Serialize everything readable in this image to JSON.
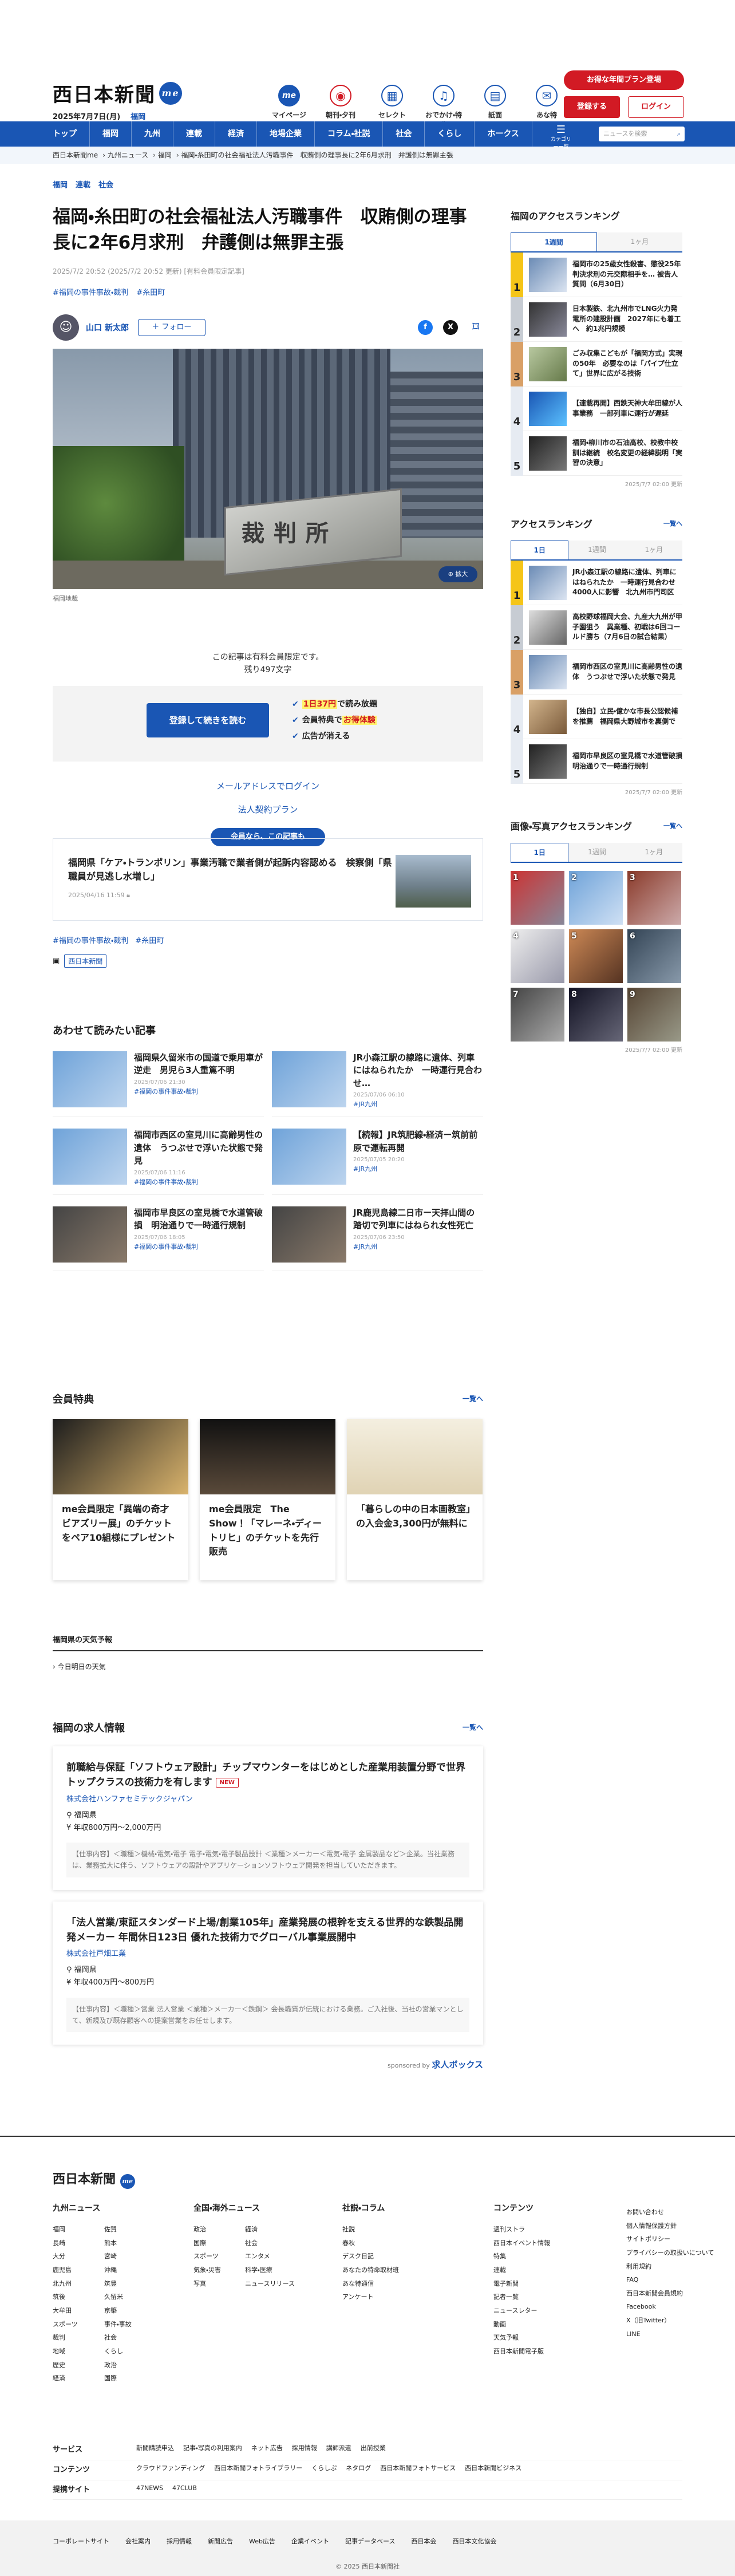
{
  "header": {
    "logo": "西日本新聞",
    "logo_me": "me",
    "date": "2025年7月7日(月)",
    "region": "福岡",
    "icons": [
      {
        "label": "マイページ",
        "icon": "me-icon"
      },
      {
        "label": "朝刊・夕刊",
        "icon": "newspaper-icon"
      },
      {
        "label": "セレクト",
        "icon": "select-icon"
      },
      {
        "label": "おでかけ・特典",
        "icon": "outing-icon"
      },
      {
        "label": "紙面",
        "icon": "paper-icon"
      },
      {
        "label": "あな特",
        "icon": "anatoku-icon"
      }
    ],
    "campaign": "お得な年間プラン登場",
    "register": "登録する",
    "login": "ログイン"
  },
  "gnav": {
    "items": [
      "トップ",
      "福岡",
      "九州",
      "連載",
      "経済",
      "地場企業",
      "コラム・社説",
      "社会",
      "くらし",
      "ホークス"
    ],
    "category_menu": "カテゴリー一覧",
    "search_placeholder": "ニュースを検索"
  },
  "breadcrumb": [
    "西日本新聞me",
    "九州ニュース",
    "福岡",
    "福岡・糸田町の社会福祉法人汚職事件　収賄側の理事長に2年6月求刑　弁護側は無罪主張"
  ],
  "article": {
    "tags": [
      "福岡",
      "連載",
      "社会"
    ],
    "title": "福岡・糸田町の社会福祉法人汚職事件　収賄側の理事長に2年6月求刑　弁護側は無罪主張",
    "date": "2025/7/2 20:52 (2025/7/2 20:52 更新) [有料会員限定記事]",
    "categories": [
      "#福岡の事件事故・裁判",
      "#糸田町"
    ],
    "author": "山口 新太郎",
    "follow": "＋ フォロー",
    "photo_sign": "裁判所",
    "zoom": "拡大",
    "caption": "福岡地裁",
    "pay_msg1": "この記事は有料会員限定です。",
    "pay_msg2": "残り497文字",
    "pay_btn": "登録して続きを読む",
    "perk1_pre": "1日37円",
    "perk1_post": "で読み放題",
    "perk2_pre": "会員特典で",
    "perk2_hl": "お得体験",
    "perk3": "広告が消える",
    "mail_login": "メールアドレスでログイン",
    "corp_plan": "法人契約プラン",
    "ribbon": "会員なら、この記事も",
    "next_title": "福岡県「ケア・トランポリン」事業汚職で業者側が起訴内容認める　検察側「県職員が見逃し水増し」",
    "next_date": "2025/04/16 11:59",
    "tags2": [
      "#福岡の事件事故・裁判",
      "#糸田町"
    ],
    "publisher": "西日本新聞"
  },
  "related": {
    "title": "あわせて読みたい記事",
    "items": [
      {
        "title": "福岡県久留米市の国道で乗用車が逆走　男児ら3人重篤不明",
        "date": "2025/07/06 21:30",
        "cat": "#福岡の事件事故・裁判"
      },
      {
        "title": "JR小森江駅の線路に遺体、列車にはねられたか　一時運行見合わせ…",
        "date": "2025/07/06 06:10",
        "cat": "#JR九州"
      },
      {
        "title": "福岡市西区の室見川に高齢男性の遺体　うつぶせで浮いた状態で発見",
        "date": "2025/07/06 11:16",
        "cat": "#福岡の事件事故・裁判"
      },
      {
        "title": "【続報】JR筑肥線・経済ー筑前前原で運転再開",
        "date": "2025/07/05 20:20",
        "cat": "#JR九州"
      },
      {
        "title": "福岡市早良区の室見橋で水道管破損　明治通りで一時通行規制",
        "date": "2025/07/06 18:05",
        "cat": "#福岡の事件事故・裁判"
      },
      {
        "title": "JR鹿児島線二日市ー天拝山間の踏切で列車にはねられ女性死亡",
        "date": "2025/07/06 23:50",
        "cat": "#JR九州"
      }
    ]
  },
  "members": {
    "title": "会員特典",
    "more": "一覧へ",
    "items": [
      {
        "title": "me会員限定「異端の奇才 ビアズリー展」のチケットをペア10組様にプレゼント"
      },
      {
        "title": "me会員限定　The Show！「マレーネ・ディートリヒ」のチケットを先行販売"
      },
      {
        "title": "「暮らしの中の日本画教室」の入会金3,300円が無料に"
      }
    ]
  },
  "weather": {
    "title": "福岡県の天気予報",
    "link": "今日明日の天気"
  },
  "jobs": {
    "title": "福岡の求人情報",
    "more": "一覧へ",
    "items": [
      {
        "title": "前職給与保証「ソフトウェア設計」チップマウンターをはじめとした産業用装置分野で世界トップクラスの技術力を有します",
        "new": "NEW",
        "company": "株式会社ハンファセミテックジャパン",
        "place": "福岡県",
        "salary": "年収800万円〜2,000万円",
        "desc": "【仕事内容】＜職種＞機械・電気・電子 電子・電気・電子製品設計 ＜業種＞メーカー＜電気・電子 金属製品など＞企業。当社業務は、業務拡大に伴う、ソフトウェアの設計やアプリケーションソフトウェア開発を担当していただきます。"
      },
      {
        "title": "「法人営業/東証スタンダード上場/創業105年」産業発展の根幹を支える世界的な鉄製品開発メーカー 年間休日123日 優れた技術力でグローバル事業展開中",
        "new": "",
        "company": "株式会社戸畑工業",
        "place": "福岡県",
        "salary": "年収400万円〜800万円",
        "desc": "【仕事内容】＜職種＞営業 法人営業 ＜業種＞メーカー＜鉄鋼＞ 会長職質が伝統における業務。ご入社後、当社の営業マンとして、新規及び既存顧客への提案営業をお任せします。"
      }
    ],
    "sponsor": "sponsored by",
    "sponsor_name": "求人ボックス"
  },
  "side": {
    "area_title": "福岡のアクセスランキング",
    "area_tabs": [
      "1週間",
      "1ヶ月"
    ],
    "area_items": [
      "福岡市の25歳女性殺害、懲役25年判決求刑の元交際相手を… 被告人質問（6月30日）",
      "日本製鉄、北九州市でLNG火力発電所の建設計画　2027年にも着工へ　約1兆円規模",
      "ごみ収集こどもが「福岡方式」実現の50年　必要なのは「パイプ仕立て」世界に広がる技術",
      "【連載再開】西鉄天神大牟田線が人事業務　一部列車に運行が遅延",
      "福岡・柳川市の石油高校、校教中校訓は継続　校名変更の経緯説明「実習の決意」"
    ],
    "area_updated": "2025/7/7 02:00 更新",
    "access_title": "アクセスランキング",
    "access_more": "一覧へ",
    "access_tabs": [
      "1日",
      "1週間",
      "1ヶ月"
    ],
    "access_items": [
      "JR小森江駅の線路に遺体、列車にはねられたか　一時運行見合わせ4000人に影響　北九州市門司区",
      "高校野球福岡大会、九産大九州が甲子園狙う　異業種、初戦は6回コールド勝ち（7月6日の試合結果）",
      "福岡市西区の室見川に高齢男性の遺体　うつぶせで浮いた状態で発見",
      "【独自】立民・億かな市長公認候補を推薦　福岡県大野城市を裏側で",
      "福岡市早良区の室見橋で水道管破損　明治通りで一時通行規制"
    ],
    "access_updated": "2025/7/7 02:00 更新",
    "photo_title": "画像・写真アクセスランキング",
    "photo_more": "一覧へ",
    "photo_tabs": [
      "1日",
      "1週間",
      "1ヶ月"
    ],
    "photo_nums": [
      "1",
      "2",
      "3",
      "4",
      "5",
      "6",
      "7",
      "8",
      "9"
    ],
    "photo_updated": "2025/7/7 02:00 更新"
  },
  "footer": {
    "logo": "西日本新聞",
    "cols": [
      {
        "title": "九州ニュース",
        "items": [
          "福岡",
          "佐賀",
          "長崎",
          "熊本",
          "大分",
          "宮崎",
          "鹿児島",
          "沖縄",
          "北九州",
          "筑豊",
          "筑後",
          "久留米",
          "大牟田",
          "京築",
          "スポーツ",
          "事件・事故",
          "裁判",
          "社会",
          "地域",
          "くらし",
          "歴史",
          "政治",
          "経済",
          "国際"
        ]
      },
      {
        "title": "全国・海外ニュース",
        "items": [
          "政治",
          "経済",
          "国際",
          "社会",
          "スポーツ",
          "エンタメ",
          "気象・災害",
          "科学・医療",
          "写真",
          "ニュースリリース"
        ]
      },
      {
        "title": "社説・コラム",
        "items": [
          "社説",
          "春秋",
          "デスク日記",
          "あなたの特命取材班",
          "あな特通信",
          "アンケート"
        ]
      },
      {
        "title": "コンテンツ",
        "items": [
          "週刊ストラ",
          "西日本イベント情報",
          "特集",
          "連載",
          "電子新聞",
          "記者一覧",
          "ニュースレター",
          "動画",
          "天気予報",
          "西日本新聞電子版"
        ]
      },
      {
        "title": "",
        "items": [
          "お問い合わせ",
          "個人情報保護方針",
          "サイトポリシー",
          "プライバシーの取扱いについて",
          "利用規約",
          "FAQ",
          "西日本新聞会員規約",
          "Facebook",
          "X（旧Twitter）",
          "LINE"
        ]
      }
    ],
    "services": [
      {
        "label": "サービス",
        "items": [
          "新聞購読申込",
          "記事・写真の利用案内",
          "ネット広告",
          "採用情報",
          "講師派遣",
          "出前授業"
        ]
      },
      {
        "label": "コンテンツ",
        "items": [
          "クラウドファンディング",
          "西日本新聞フォトライブラリー",
          "くらしぷ",
          "ネタログ",
          "西日本新聞フォトサービス",
          "西日本新聞ビジネス"
        ]
      },
      {
        "label": "提携サイト",
        "items": [
          "47NEWS",
          "47CLUB"
        ]
      }
    ],
    "bottom": [
      "コーポレートサイト",
      "会社案内",
      "採用情報",
      "新聞広告",
      "Web広告",
      "企業イベント",
      "記事データベース",
      "西日本会",
      "西日本文化協会"
    ],
    "copyright": "© 2025 西日本新聞社"
  }
}
